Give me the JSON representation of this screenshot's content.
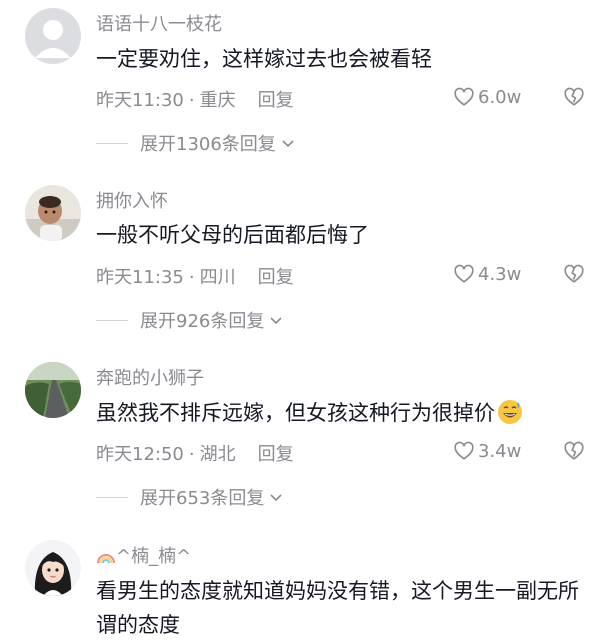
{
  "comments": [
    {
      "username": "语语十八一枝花",
      "text": "一定要劝住，这样嫁过去也会被看轻",
      "time": "昨天11:30",
      "sep": "·",
      "location": "重庆",
      "reply_label": "回复",
      "likes": "6.0w",
      "expand_label": "展开1306条回复"
    },
    {
      "username": "拥你入怀",
      "text": "一般不听父母的后面都后悔了",
      "time": "昨天11:35",
      "sep": "·",
      "location": "四川",
      "reply_label": "回复",
      "likes": "4.3w",
      "expand_label": "展开926条回复"
    },
    {
      "username": "奔跑的小狮子",
      "text": "虽然我不排斥远嫁，但女孩这种行为很掉价",
      "emoji": "grinning-sweat-emoji",
      "time": "昨天12:50",
      "sep": "·",
      "location": "湖北",
      "reply_label": "回复",
      "likes": "3.4w",
      "expand_label": "展开653条回复"
    },
    {
      "username": "^楠_楠^",
      "username_icon": "rainbow-icon",
      "text": "看男生的态度就知道妈妈没有错，这个男生一副无所谓的态度"
    }
  ],
  "colors": {
    "text": "#161823",
    "secondary": "#8a8b91",
    "divider": "#d3d4d8"
  }
}
